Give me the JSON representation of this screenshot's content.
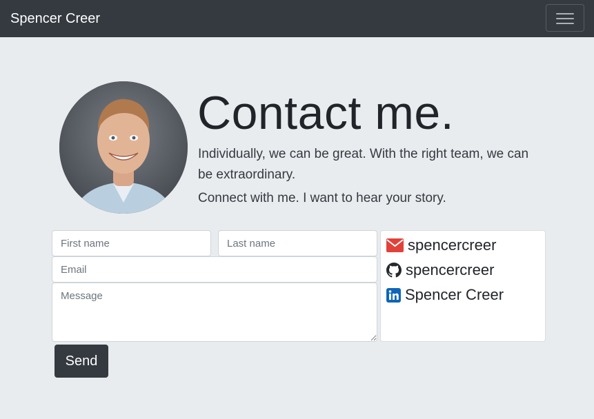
{
  "navbar": {
    "brand": "Spencer Creer",
    "toggler_icon": "hamburger-menu-icon"
  },
  "header": {
    "title": "Contact me.",
    "lead1": "Individually, we can be great. With the right team, we can be extraordinary.",
    "lead2": "Connect with me. I want to hear your story."
  },
  "form": {
    "first_name_placeholder": "First name",
    "last_name_placeholder": "Last name",
    "email_placeholder": "Email",
    "message_placeholder": "Message",
    "send_label": "Send"
  },
  "social": [
    {
      "icon": "envelope-icon",
      "label": "spencercreer",
      "color": "#e0423a"
    },
    {
      "icon": "github-icon",
      "label": "spencercreer",
      "color": "#24292e"
    },
    {
      "icon": "linkedin-icon",
      "label": "Spencer Creer",
      "color": "#0e66b8"
    }
  ],
  "colors": {
    "navbar_bg": "#343a40",
    "page_bg": "#e9ecef",
    "button_bg": "#343a40"
  }
}
